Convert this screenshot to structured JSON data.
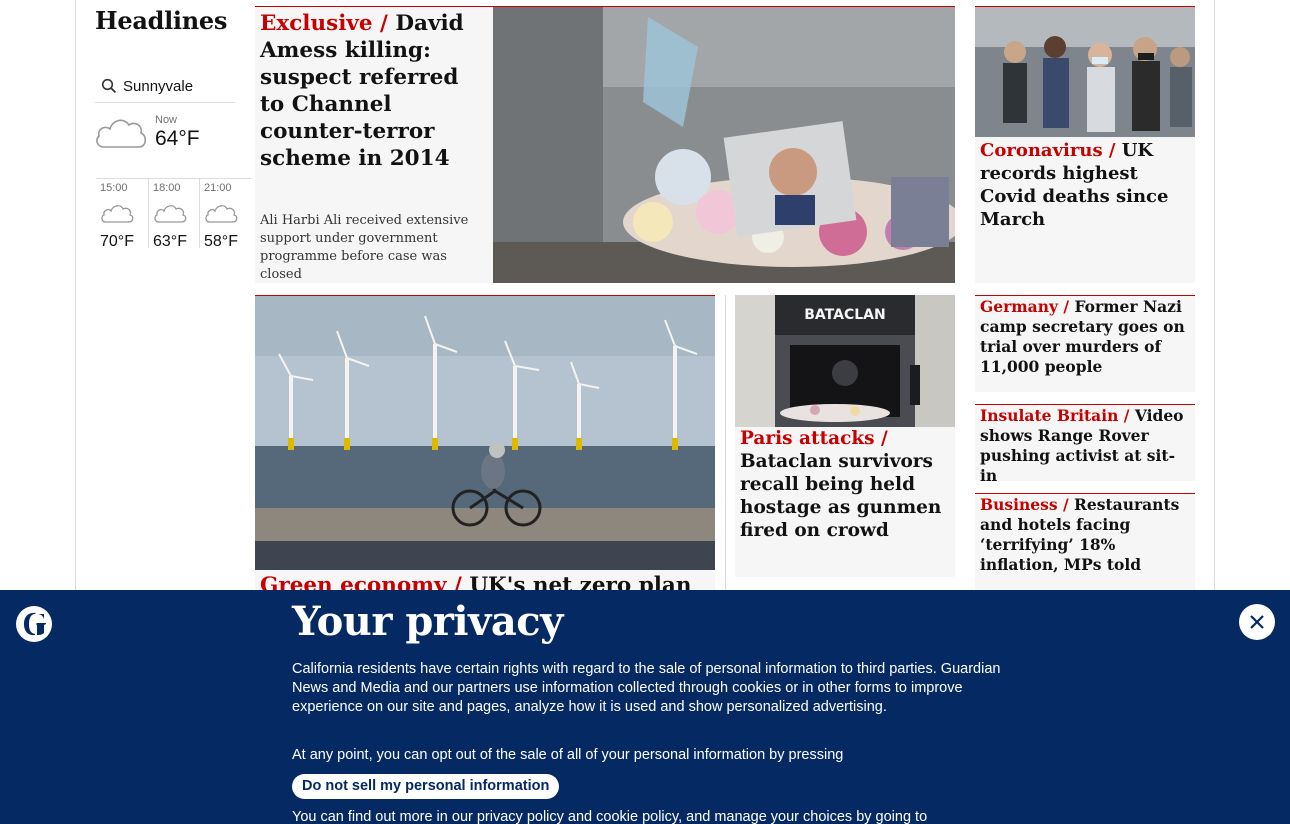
{
  "sidebar": {
    "title": "Headlines",
    "location": "Sunnyvale",
    "now_label": "Now",
    "now_temp": "64°F",
    "forecast": [
      {
        "time": "15:00",
        "temp": "70°F",
        "icon": "cloud-icon"
      },
      {
        "time": "18:00",
        "temp": "63°F",
        "icon": "cloud-icon"
      },
      {
        "time": "21:00",
        "temp": "58°F",
        "icon": "cloud-icon"
      }
    ]
  },
  "stories": {
    "lead": {
      "kicker": "Exclusive / ",
      "headline": "David Amess killing: suspect referred to Channel counter-terror scheme in 2014",
      "standfirst": "Ali Harbi Ali received extensive support under government programme before case was closed"
    },
    "covid": {
      "kicker": "Coronavirus / ",
      "headline": "UK records highest Covid deaths since March"
    },
    "wind": {
      "kicker": "Green economy / ",
      "headline": "UK's net zero plan falls"
    },
    "paris": {
      "kicker": "Paris attacks / ",
      "headline": "Bataclan survivors recall being held hostage as gunmen fired on crowd",
      "sign": "BATACLAN"
    },
    "germany": {
      "kicker": "Germany / ",
      "headline": "Former Nazi camp secretary goes on trial over murders of 11,000 people"
    },
    "insulate": {
      "kicker": "Insulate Britain / ",
      "headline": "Video shows Range Rover pushing activist at sit-in"
    },
    "business": {
      "kicker": "Business / ",
      "headline": "Restaurants and hotels facing ‘terrifying’ 18% inflation, MPs told"
    }
  },
  "privacy": {
    "title": "Your privacy",
    "p1": "California residents have certain rights with regard to the sale of personal information to third parties. Guardian News and Media and our partners use information collected through cookies or in other forms to improve experience on our site and pages, analyze how it is used and show personalized advertising.",
    "p2": "At any point, you can opt out of the sale of all of your personal information by pressing",
    "button": "Do not sell my personal information",
    "p3": "You can find out more in our privacy policy and cookie policy, and manage your choices by going to"
  },
  "colors": {
    "kicker": "#c70000",
    "banner": "#052962"
  }
}
